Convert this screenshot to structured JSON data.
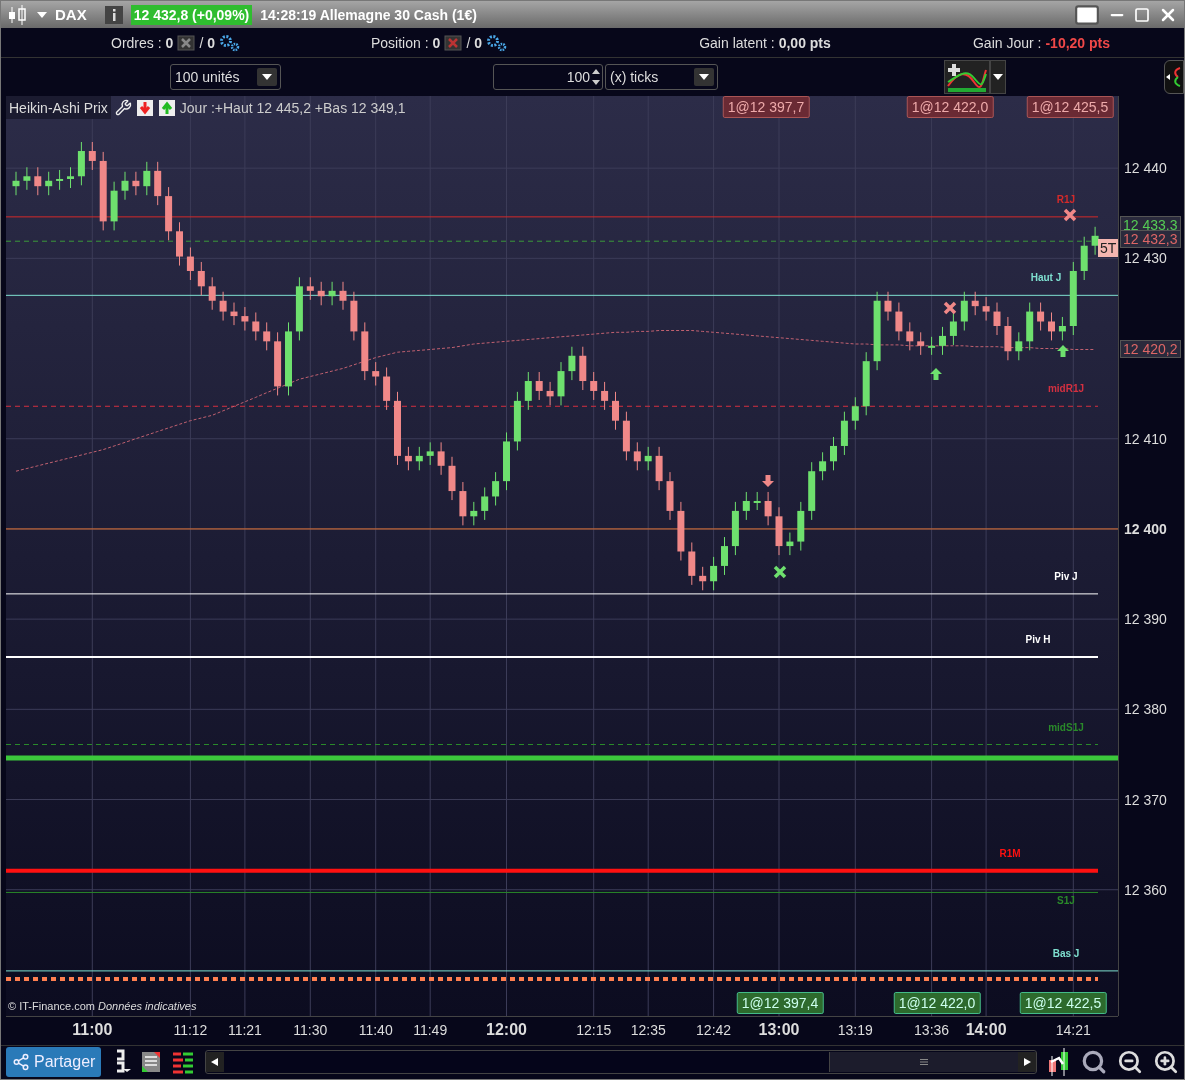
{
  "title_bar": {
    "symbol": "DAX",
    "price": "12 432,8 (+0,09%)",
    "description": "14:28:19 Allemagne 30 Cash (1€)"
  },
  "info_bar": {
    "orders": {
      "label": "Ordres :",
      "count": "0",
      "slash": "/",
      "pending": "0"
    },
    "position": {
      "label": "Position :",
      "count": "0",
      "slash": "/",
      "pending": "0"
    },
    "gains": [
      {
        "label": "Gain latent :",
        "value": "0,00 pts"
      },
      {
        "label": "Gain Jour :",
        "value": "-10,20 pts"
      }
    ]
  },
  "controls": {
    "quantity_select": "100 unités",
    "ticks_input": "100",
    "ticks_unit_select": "(x) ticks"
  },
  "chart": {
    "series_label": "Heikin-Ashi Prix",
    "day_range": "Jour :+Haut 12 445,2 +Bas 12 349,1",
    "copyright": "© IT-Finance.com *Données indicatives*",
    "sell_orders": [
      "1@12 397,7",
      "1@12 422,0",
      "1@12 425,5"
    ],
    "buy_orders": [
      "1@12 397,4",
      "1@12 422,0",
      "1@12 422,5"
    ],
    "price_tags": [
      {
        "label": "12 433,3",
        "kind": "buy"
      },
      {
        "label": "12 432,3",
        "kind": "sell"
      },
      {
        "label": "12 420,2",
        "kind": "sell"
      }
    ],
    "spread_badge": "5T",
    "chart_data": {
      "type": "candlestick",
      "ylim": [
        12346,
        12448
      ],
      "grid": true,
      "categories": [
        null,
        null,
        null,
        null,
        null,
        null,
        null,
        "11:00",
        null,
        null,
        null,
        null,
        null,
        null,
        null,
        null,
        "11:12",
        null,
        null,
        null,
        null,
        "11:21",
        null,
        null,
        null,
        null,
        null,
        "11:30",
        null,
        null,
        null,
        null,
        null,
        "11:40",
        null,
        null,
        null,
        null,
        "11:49",
        null,
        null,
        null,
        null,
        null,
        null,
        "12:00",
        null,
        null,
        null,
        null,
        null,
        null,
        null,
        "12:15",
        null,
        null,
        null,
        null,
        "12:35",
        null,
        null,
        null,
        null,
        null,
        "12:42",
        null,
        null,
        null,
        null,
        null,
        "13:00",
        null,
        null,
        null,
        null,
        null,
        null,
        "13:19",
        null,
        null,
        null,
        null,
        null,
        null,
        "13:36",
        null,
        null,
        null,
        null,
        "14:00",
        null,
        null,
        null,
        null,
        null,
        null,
        null,
        "14:21",
        null,
        null
      ],
      "yticks": [
        {
          "value": 12440,
          "label": "12 440"
        },
        {
          "value": 12430,
          "label": "12 430"
        },
        {
          "value": 12410,
          "label": "12 410"
        },
        {
          "value": 12400,
          "label": "12 400"
        },
        {
          "value": 12390,
          "label": "12 390"
        },
        {
          "value": 12380,
          "label": "12 380"
        },
        {
          "value": 12370,
          "label": "12 370"
        },
        {
          "value": 12360,
          "label": "12 360"
        }
      ],
      "ohlc": [
        [
          12438.0,
          12439.6,
          12437.0,
          12438.6
        ],
        [
          12438.6,
          12440.1,
          12437.6,
          12439.1
        ],
        [
          12439.1,
          12440.1,
          12437.0,
          12438.0
        ],
        [
          12438.0,
          12439.6,
          12437.0,
          12438.6
        ],
        [
          12438.6,
          12439.8,
          12437.6,
          12438.8
        ],
        [
          12438.8,
          12440.1,
          12437.8,
          12439.1
        ],
        [
          12439.1,
          12442.9,
          12438.1,
          12441.9
        ],
        [
          12441.9,
          12442.9,
          12439.8,
          12440.8
        ],
        [
          12440.8,
          12441.8,
          12433.1,
          12434.1
        ],
        [
          12434.1,
          12438.5,
          12433.1,
          12437.5
        ],
        [
          12437.5,
          12439.6,
          12436.5,
          12438.6
        ],
        [
          12438.6,
          12439.6,
          12437.0,
          12438.0
        ],
        [
          12438.0,
          12440.7,
          12437.0,
          12439.7
        ],
        [
          12439.7,
          12440.7,
          12435.9,
          12436.9
        ],
        [
          12436.9,
          12437.9,
          12432.0,
          12433.0
        ],
        [
          12433.0,
          12434.0,
          12429.2,
          12430.2
        ],
        [
          12430.2,
          12431.2,
          12427.6,
          12428.6
        ],
        [
          12428.6,
          12429.6,
          12425.9,
          12426.9
        ],
        [
          12426.9,
          12427.9,
          12424.3,
          12425.3
        ],
        [
          12425.3,
          12426.3,
          12423.1,
          12424.1
        ],
        [
          12424.1,
          12425.1,
          12422.6,
          12423.6
        ],
        [
          12423.6,
          12424.6,
          12422.0,
          12423.0
        ],
        [
          12423.0,
          12424.0,
          12420.9,
          12421.9
        ],
        [
          12421.9,
          12422.9,
          12419.8,
          12420.8
        ],
        [
          12420.8,
          12421.8,
          12414.8,
          12415.8
        ],
        [
          12415.8,
          12422.9,
          12414.8,
          12421.9
        ],
        [
          12421.9,
          12427.9,
          12420.9,
          12426.9
        ],
        [
          12426.9,
          12427.9,
          12425.4,
          12426.4
        ],
        [
          12426.4,
          12427.4,
          12424.8,
          12425.8
        ],
        [
          12425.8,
          12427.4,
          12424.8,
          12426.4
        ],
        [
          12426.4,
          12427.4,
          12424.3,
          12425.3
        ],
        [
          12425.3,
          12426.3,
          12420.9,
          12421.9
        ],
        [
          12421.9,
          12422.9,
          12416.5,
          12417.5
        ],
        [
          12417.5,
          12418.5,
          12415.9,
          12416.9
        ],
        [
          12416.9,
          12417.9,
          12413.2,
          12414.2
        ],
        [
          12414.2,
          12415.2,
          12407.1,
          12408.1
        ],
        [
          12408.1,
          12409.1,
          12406.5,
          12407.5
        ],
        [
          12407.5,
          12409.1,
          12406.5,
          12408.1
        ],
        [
          12408.1,
          12409.6,
          12407.1,
          12408.6
        ],
        [
          12408.6,
          12409.6,
          12406.0,
          12407.0
        ],
        [
          12407.0,
          12408.0,
          12403.2,
          12404.2
        ],
        [
          12404.2,
          12405.2,
          12400.4,
          12401.4
        ],
        [
          12401.4,
          12403.0,
          12400.4,
          12402.0
        ],
        [
          12402.0,
          12404.6,
          12401.0,
          12403.6
        ],
        [
          12403.6,
          12406.3,
          12402.6,
          12405.3
        ],
        [
          12405.3,
          12410.7,
          12404.3,
          12409.7
        ],
        [
          12409.7,
          12415.2,
          12408.7,
          12414.2
        ],
        [
          12414.2,
          12417.4,
          12413.2,
          12416.4
        ],
        [
          12416.4,
          12417.4,
          12414.3,
          12415.3
        ],
        [
          12415.3,
          12416.3,
          12413.7,
          12414.7
        ],
        [
          12414.7,
          12418.5,
          12413.7,
          12417.5
        ],
        [
          12417.5,
          12420.2,
          12416.5,
          12419.2
        ],
        [
          12419.2,
          12420.2,
          12415.4,
          12416.4
        ],
        [
          12416.4,
          12417.4,
          12414.3,
          12415.3
        ],
        [
          12415.3,
          12416.3,
          12413.2,
          12414.2
        ],
        [
          12414.2,
          12415.2,
          12411.0,
          12412.0
        ],
        [
          12412.0,
          12413.0,
          12407.6,
          12408.6
        ],
        [
          12408.6,
          12409.6,
          12406.5,
          12407.5
        ],
        [
          12407.5,
          12409.1,
          12406.5,
          12408.1
        ],
        [
          12408.1,
          12409.1,
          12404.3,
          12405.3
        ],
        [
          12405.3,
          12406.3,
          12401.0,
          12402.0
        ],
        [
          12402.0,
          12403.0,
          12396.5,
          12397.5
        ],
        [
          12397.5,
          12398.5,
          12393.8,
          12394.8
        ],
        [
          12394.8,
          12395.8,
          12393.2,
          12394.2
        ],
        [
          12394.2,
          12396.9,
          12393.2,
          12395.9
        ],
        [
          12395.9,
          12399.1,
          12394.9,
          12398.1
        ],
        [
          12398.1,
          12403.0,
          12397.1,
          12402.0
        ],
        [
          12402.0,
          12404.1,
          12401.0,
          12403.1
        ],
        [
          12403.1,
          12404.1,
          12402.1,
          12403.1
        ],
        [
          12403.1,
          12404.1,
          12400.4,
          12401.4
        ],
        [
          12401.4,
          12402.4,
          12397.1,
          12398.1
        ],
        [
          12398.1,
          12399.6,
          12397.1,
          12398.6
        ],
        [
          12398.6,
          12403.0,
          12397.6,
          12402.0
        ],
        [
          12402.0,
          12407.4,
          12401.0,
          12406.4
        ],
        [
          12406.4,
          12408.5,
          12405.4,
          12407.5
        ],
        [
          12407.5,
          12410.2,
          12406.5,
          12409.2
        ],
        [
          12409.2,
          12413.0,
          12408.2,
          12412.0
        ],
        [
          12412.0,
          12414.6,
          12411.0,
          12413.6
        ],
        [
          12413.6,
          12419.6,
          12412.6,
          12418.6
        ],
        [
          12418.6,
          12426.3,
          12417.6,
          12425.3
        ],
        [
          12425.3,
          12426.3,
          12423.1,
          12424.1
        ],
        [
          12424.1,
          12425.1,
          12420.9,
          12421.9
        ],
        [
          12421.9,
          12422.9,
          12419.8,
          12420.8
        ],
        [
          12420.8,
          12421.8,
          12419.3,
          12420.3
        ],
        [
          12420.3,
          12421.3,
          12419.3,
          12420.3
        ],
        [
          12420.3,
          12422.4,
          12419.3,
          12421.4
        ],
        [
          12421.4,
          12424.0,
          12420.4,
          12423.0
        ],
        [
          12423.0,
          12426.3,
          12422.0,
          12425.3
        ],
        [
          12425.3,
          12426.3,
          12423.7,
          12424.7
        ],
        [
          12424.7,
          12425.7,
          12423.1,
          12424.1
        ],
        [
          12424.1,
          12425.1,
          12421.5,
          12422.5
        ],
        [
          12422.5,
          12423.5,
          12418.7,
          12419.7
        ],
        [
          12419.7,
          12421.8,
          12418.7,
          12420.8
        ],
        [
          12420.8,
          12425.1,
          12419.8,
          12424.1
        ],
        [
          12424.1,
          12425.1,
          12422.0,
          12423.0
        ],
        [
          12423.0,
          12424.0,
          12420.9,
          12421.9
        ],
        [
          12421.9,
          12423.5,
          12420.9,
          12422.5
        ],
        [
          12422.5,
          12429.6,
          12421.5,
          12428.6
        ],
        [
          12428.6,
          12432.4,
          12427.6,
          12431.4
        ],
        [
          12431.4,
          12433.5,
          12430.4,
          12432.5
        ]
      ],
      "series": [
        {
          "type": "line",
          "line_style": "dashed",
          "color": "#c06070",
          "values": [
            12406.4,
            12406.7,
            12407.0,
            12407.3,
            12407.6,
            12407.9,
            12408.2,
            12408.5,
            12408.8,
            12409.2,
            12409.6,
            12410.0,
            12410.4,
            12410.8,
            12411.2,
            12411.6,
            12412.0,
            12412.3,
            12412.6,
            12413.1,
            12413.6,
            12414.1,
            12414.6,
            12415.1,
            12415.6,
            12416.1,
            12416.6,
            12416.9,
            12417.2,
            12417.5,
            12417.8,
            12418.2,
            12418.6,
            12419.0,
            12419.3,
            12419.6,
            12419.7,
            12419.8,
            12419.9,
            12420.0,
            12420.1,
            12420.3,
            12420.5,
            12420.6,
            12420.7,
            12420.8,
            12420.9,
            12421.0,
            12421.1,
            12421.2,
            12421.3,
            12421.4,
            12421.5,
            12421.6,
            12421.7,
            12421.8,
            12421.8,
            12421.9,
            12421.9,
            12422.0,
            12422.0,
            12422.0,
            12422.0,
            12421.9,
            12421.8,
            12421.7,
            12421.6,
            12421.5,
            12421.4,
            12421.3,
            12421.2,
            12421.1,
            12421.0,
            12420.9,
            12420.8,
            12420.7,
            12420.6,
            12420.5,
            12420.5,
            12420.4,
            12420.4,
            12420.4,
            12420.3,
            12420.3,
            12420.3,
            12420.3,
            12420.3,
            12420.3,
            12420.2,
            12420.2,
            12420.2,
            12420.1,
            12420.1,
            12420.1,
            12420.0,
            12420.0,
            12420.0,
            12419.9,
            12419.9,
            12419.9
          ]
        }
      ],
      "ref_lines": [
        {
          "axis": "y",
          "value": 12434.6,
          "label": "R1J",
          "color": "#d42a2a"
        },
        {
          "axis": "y",
          "value": 12431.9,
          "color": "#3a9a3a"
        },
        {
          "axis": "y",
          "value": 12425.9,
          "label": "Haut J",
          "color": "#7fe0d0"
        },
        {
          "axis": "y",
          "value": 12413.6,
          "label": "midR1J",
          "color": "#d43040"
        },
        {
          "axis": "y",
          "value": 12400.0,
          "color": "#e07030"
        },
        {
          "axis": "y",
          "value": 12392.8,
          "label": "Piv J",
          "color": "#ffffff"
        },
        {
          "axis": "y",
          "value": 12385.8,
          "label": "Piv H",
          "color": "#ffffff"
        },
        {
          "axis": "y",
          "value": 12376.1,
          "label": "midS1J",
          "color": "#2a8a2a"
        },
        {
          "axis": "y",
          "value": 12374.6,
          "color": "#3cc83c"
        },
        {
          "axis": "y",
          "value": 12362.1,
          "label": "R1M",
          "color": "#ff1010"
        },
        {
          "axis": "y",
          "value": 12359.7,
          "label": "S1J",
          "color": "#2a8a2a"
        },
        {
          "axis": "y",
          "value": 12351.0,
          "label": "Bas J",
          "color": "#7fe0d0"
        },
        {
          "axis": "y",
          "value": 12350.1,
          "color": "#ff7f50"
        }
      ]
    }
  },
  "toolbar": {
    "share_button": "Partager"
  }
}
